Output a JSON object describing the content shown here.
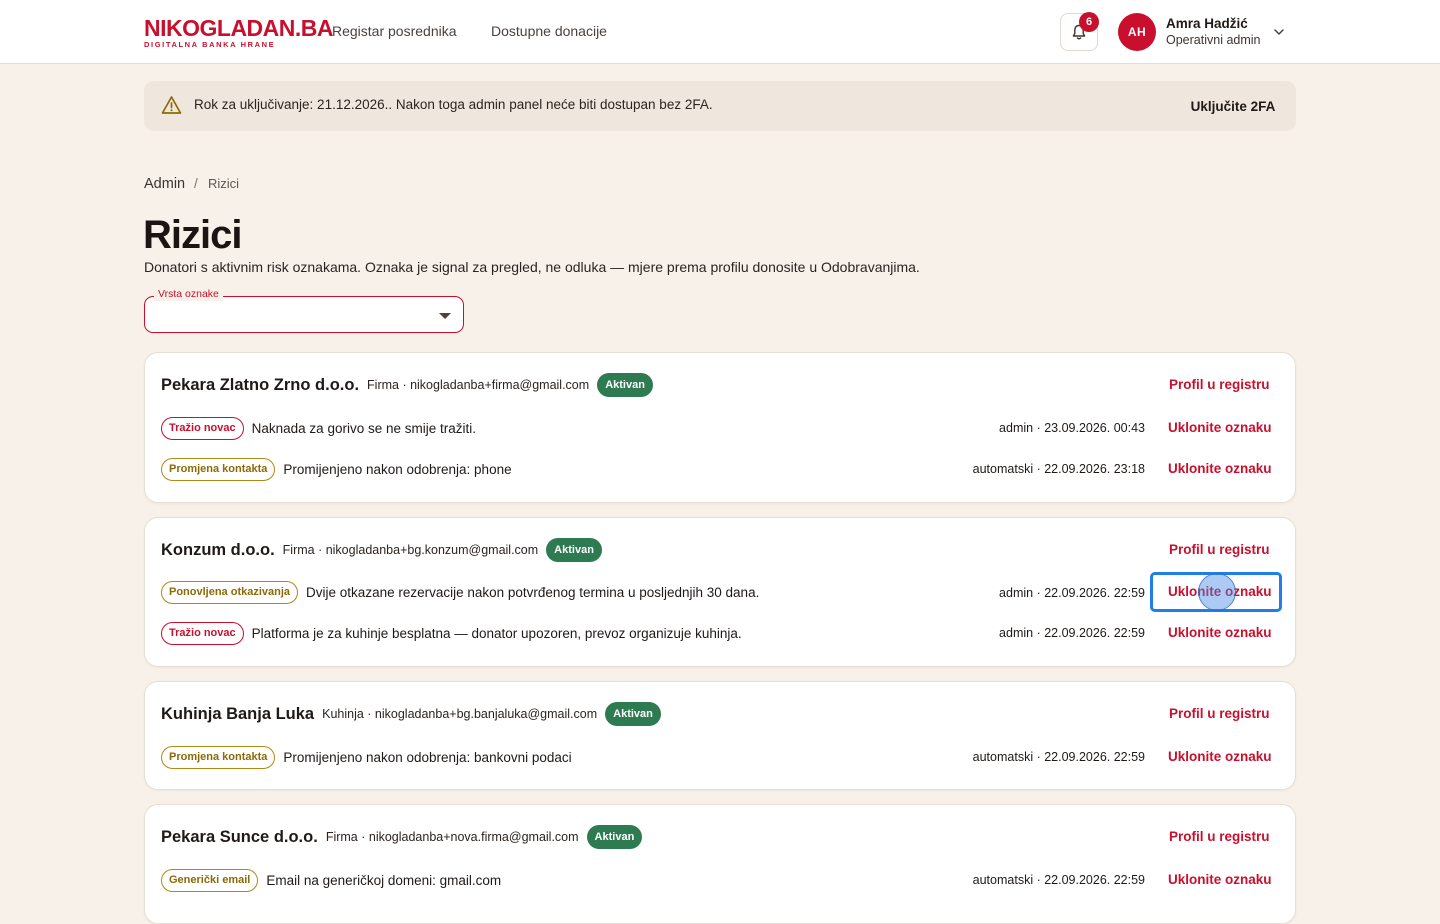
{
  "header": {
    "logo_main": "NIKOGLADAN.BA",
    "logo_sub": "DIGITALNA BANKA HRANE",
    "nav": [
      "Registar posrednika",
      "Dostupne donacije"
    ],
    "notifications_count": "6",
    "user": {
      "initials": "AH",
      "name": "Amra Hadžić",
      "role": "Operativni admin"
    }
  },
  "banner": {
    "text": "Rok za uključivanje: 21.12.2026.. Nakon toga admin panel neće biti dostupan bez 2FA.",
    "action": "Uključite 2FA"
  },
  "breadcrumb": {
    "root": "Admin",
    "separator": "/",
    "current": "Rizici"
  },
  "page": {
    "title": "Rizici",
    "description": "Donatori s aktivnim risk oznakama. Oznaka je signal za pregled, ne odluka — mjere prema profilu donosite u Odobravanjima."
  },
  "filter": {
    "label": "Vrsta oznake",
    "value": ""
  },
  "labels": {
    "profile_link": "Profil u registru",
    "remove_flag": "Uklonite oznaku"
  },
  "colors": {
    "brand_red": "#c8102e",
    "status_green": "#2e7a51",
    "focus_blue": "#1e7fe6"
  },
  "donors": [
    {
      "name": "Pekara Zlatno Zrno d.o.o.",
      "meta": "Firma · nikogladanba+firma@gmail.com",
      "status": "Aktivan",
      "flags": [
        {
          "tag": "Tražio novac",
          "tone": "red",
          "text": "Naknada za gorivo se ne smije tražiti.",
          "meta": "admin · 23.09.2026. 00:43"
        },
        {
          "tag": "Promjena kontakta",
          "tone": "gold",
          "text": "Promijenjeno nakon odobrenja: phone",
          "meta": "automatski · 22.09.2026. 23:18"
        }
      ]
    },
    {
      "name": "Konzum d.o.o.",
      "meta": "Firma · nikogladanba+bg.konzum@gmail.com",
      "status": "Aktivan",
      "flags": [
        {
          "tag": "Ponovljena otkazivanja",
          "tone": "gold",
          "text": "Dvije otkazane rezervacije nakon potvrđenog termina u posljednjih 30 dana.",
          "meta": "admin · 22.09.2026. 22:59"
        },
        {
          "tag": "Tražio novac",
          "tone": "red",
          "text": "Platforma je za kuhinje besplatna — donator upozoren, prevoz organizuje kuhinja.",
          "meta": "admin · 22.09.2026. 22:59"
        }
      ]
    },
    {
      "name": "Kuhinja Banja Luka",
      "meta": "Kuhinja · nikogladanba+bg.banjaluka@gmail.com",
      "status": "Aktivan",
      "flags": [
        {
          "tag": "Promjena kontakta",
          "tone": "gold",
          "text": "Promijenjeno nakon odobrenja: bankovni podaci",
          "meta": "automatski · 22.09.2026. 22:59"
        }
      ]
    },
    {
      "name": "Pekara Sunce d.o.o.",
      "meta": "Firma · nikogladanba+nova.firma@gmail.com",
      "status": "Aktivan",
      "flags": [
        {
          "tag": "Generički email",
          "tone": "gold",
          "text": "Email na generičkoj domeni: gmail.com",
          "meta": "automatski · 22.09.2026. 22:59"
        }
      ]
    }
  ]
}
